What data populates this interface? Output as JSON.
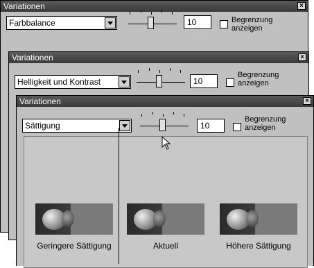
{
  "windows": [
    {
      "title": "Variationen",
      "combo_value": "Farbbalance",
      "number_value": "10",
      "checkbox_label_line1": "Begrenzung",
      "checkbox_label_line2": "anzeigen"
    },
    {
      "title": "Variationen",
      "combo_value": "Helligkeit und Kontrast",
      "number_value": "10",
      "checkbox_label_line1": "Begrenzung",
      "checkbox_label_line2": "anzeigen"
    },
    {
      "title": "Variationen",
      "combo_value": "Sättigung",
      "number_value": "10",
      "checkbox_label_line1": "Begrenzung",
      "checkbox_label_line2": "anzeigen",
      "previews": [
        "Geringere Sättigung",
        "Aktuell",
        "Höhere Sättigung"
      ]
    }
  ],
  "icons": {
    "close": "close-icon",
    "dropdown": "chevron-down-icon",
    "cursor": "mouse-pointer-icon"
  }
}
